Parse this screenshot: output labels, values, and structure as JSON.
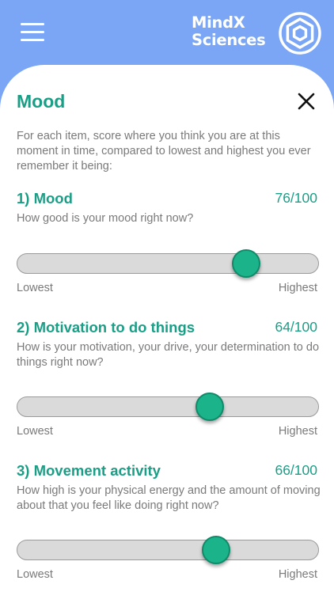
{
  "brand": {
    "line1": "MindX",
    "line2": "Sciences"
  },
  "page": {
    "title": "Mood",
    "intro": "For each item, score where you think you are at this moment in time, compared to lowest and highest you ever remember it being:"
  },
  "scale": {
    "low": "Lowest",
    "high": "Highest"
  },
  "items": [
    {
      "title": "1) Mood",
      "score": "76/100",
      "value": 76,
      "question": "How good is your mood right now?"
    },
    {
      "title": "2) Motivation to do things",
      "score": "64/100",
      "value": 64,
      "question": "How is your motivation, your drive, your determination to do things right now?"
    },
    {
      "title": "3) Movement activity",
      "score": "66/100",
      "value": 66,
      "question": "How high is your physical energy and the amount of moving about that you feel like doing right now?"
    }
  ],
  "colors": {
    "header_bg": "#7aa6f5",
    "accent": "#1a9e86",
    "slider_thumb": "#1ab38a",
    "body_text": "#7a7a7a"
  },
  "icons": {
    "menu": "hamburger-menu-icon",
    "logo": "hexagon-target-logo",
    "close": "close-x-icon"
  }
}
